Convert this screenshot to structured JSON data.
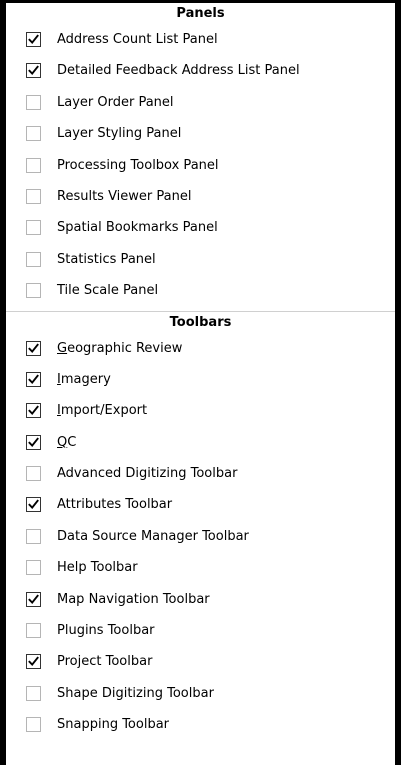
{
  "menu": {
    "panels_header": "Panels",
    "toolbars_header": "Toolbars",
    "panels": [
      {
        "label": "Address Count List Panel",
        "checked": true
      },
      {
        "label": "Detailed Feedback Address List Panel",
        "checked": true
      },
      {
        "label": "Layer Order Panel",
        "checked": false
      },
      {
        "label": "Layer Styling Panel",
        "checked": false
      },
      {
        "label": "Processing Toolbox Panel",
        "checked": false
      },
      {
        "label": "Results Viewer Panel",
        "checked": false
      },
      {
        "label": "Spatial Bookmarks Panel",
        "checked": false
      },
      {
        "label": "Statistics Panel",
        "checked": false
      },
      {
        "label": "Tile Scale Panel",
        "checked": false
      }
    ],
    "toolbars": [
      {
        "label_first": "G",
        "label_rest": "eographic Review",
        "checked": true
      },
      {
        "label_first": "I",
        "label_rest": "magery",
        "checked": true
      },
      {
        "label_first": "I",
        "label_rest": "mport/Export",
        "checked": true
      },
      {
        "label_first": "Q",
        "label_rest": "C",
        "checked": true
      },
      {
        "label_first": "",
        "label_rest": "Advanced Digitizing Toolbar",
        "checked": false
      },
      {
        "label_first": "",
        "label_rest": "Attributes Toolbar",
        "checked": true
      },
      {
        "label_first": "",
        "label_rest": "Data Source Manager Toolbar",
        "checked": false
      },
      {
        "label_first": "",
        "label_rest": "Help Toolbar",
        "checked": false
      },
      {
        "label_first": "",
        "label_rest": "Map Navigation Toolbar",
        "checked": true
      },
      {
        "label_first": "",
        "label_rest": "Plugins Toolbar",
        "checked": false
      },
      {
        "label_first": "",
        "label_rest": "Project Toolbar",
        "checked": true
      },
      {
        "label_first": "",
        "label_rest": "Shape Digitizing Toolbar",
        "checked": false
      },
      {
        "label_first": "",
        "label_rest": "Snapping Toolbar",
        "checked": false
      }
    ],
    "icons": {
      "check": "checkmark-icon"
    }
  }
}
